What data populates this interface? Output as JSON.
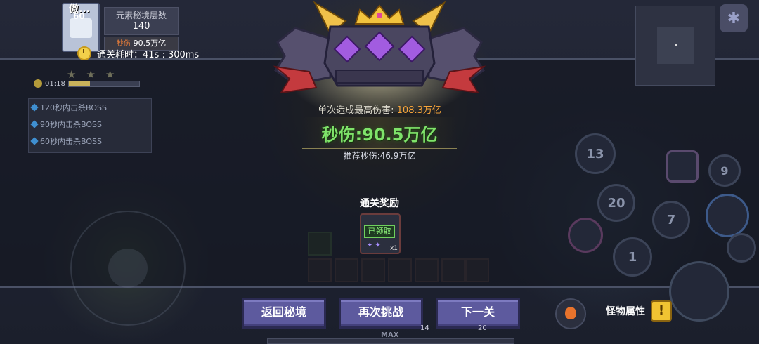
{
  "hud": {
    "player_name": "傲...",
    "player_level": "60",
    "stats": [
      {
        "label": "元素秘境层数",
        "value": "140"
      },
      {
        "label": "秒伤",
        "value": "90.5万亿"
      }
    ],
    "clear_time": "通关耗时：41s : 300ms",
    "progress_time": "01:18",
    "progress_fraction": 0.3,
    "boss_goals": [
      "120秒内击杀BOSS",
      "90秒内击杀BOSS",
      "60秒内击杀BOSS"
    ]
  },
  "skills": [
    "13",
    "9",
    "20",
    "7",
    "1"
  ],
  "result": {
    "max_damage_label": "单次造成最高伤害:",
    "max_damage_value": "108.3万亿",
    "dps": "秒伤:90.5万亿",
    "recommended_dps": "推荐秒伤:46.9万亿",
    "rewards_title": "通关奖励",
    "reward_status": "已领取",
    "reward_count": "x1"
  },
  "buttons": {
    "return": "返回秘境",
    "retry": "再次挑战",
    "next": "下一关"
  },
  "monster_attr": {
    "label": "怪物属性",
    "icon_text": "!"
  },
  "bottom": {
    "max_label": "MAX",
    "slot_counts": [
      "14",
      "20"
    ]
  },
  "colors": {
    "accent_green": "#7fe36a",
    "accent_orange": "#f7a53a",
    "button": "#5d5a9e"
  }
}
